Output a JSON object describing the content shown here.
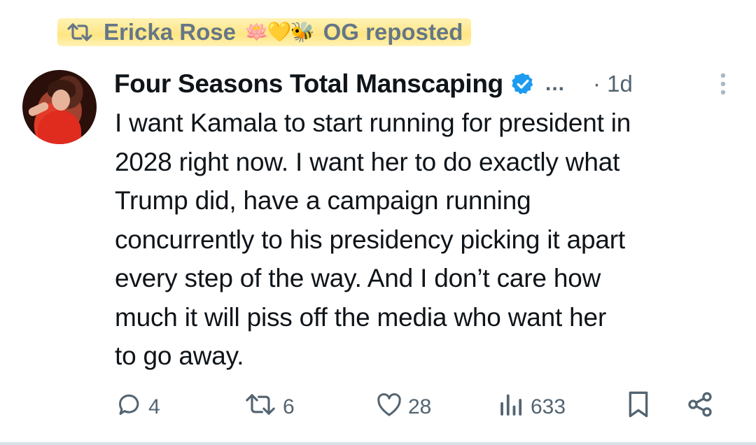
{
  "repost": {
    "user": "Ericka Rose",
    "emojis": [
      "🪷",
      "💛",
      "🐝"
    ],
    "suffix": "OG reposted"
  },
  "post": {
    "author": "Four Seasons Total Manscaping",
    "verified": true,
    "ellipsis": "...",
    "time": "· 1d",
    "text": "I want Kamala to start running for president in\n2028 right now. I want her to do exactly what\nTrump did, have a campaign running\nconcurrently to his presidency picking it apart\nevery step of the way. And I don’t care how\nmuch it will piss off the media who want her\nto go away."
  },
  "actions": {
    "replies": "4",
    "reposts": "6",
    "likes": "28",
    "views": "633"
  },
  "colors": {
    "highlight": "#ffe066",
    "muted": "#536471",
    "verified": "#1d9bf0",
    "text": "#0f1419"
  }
}
